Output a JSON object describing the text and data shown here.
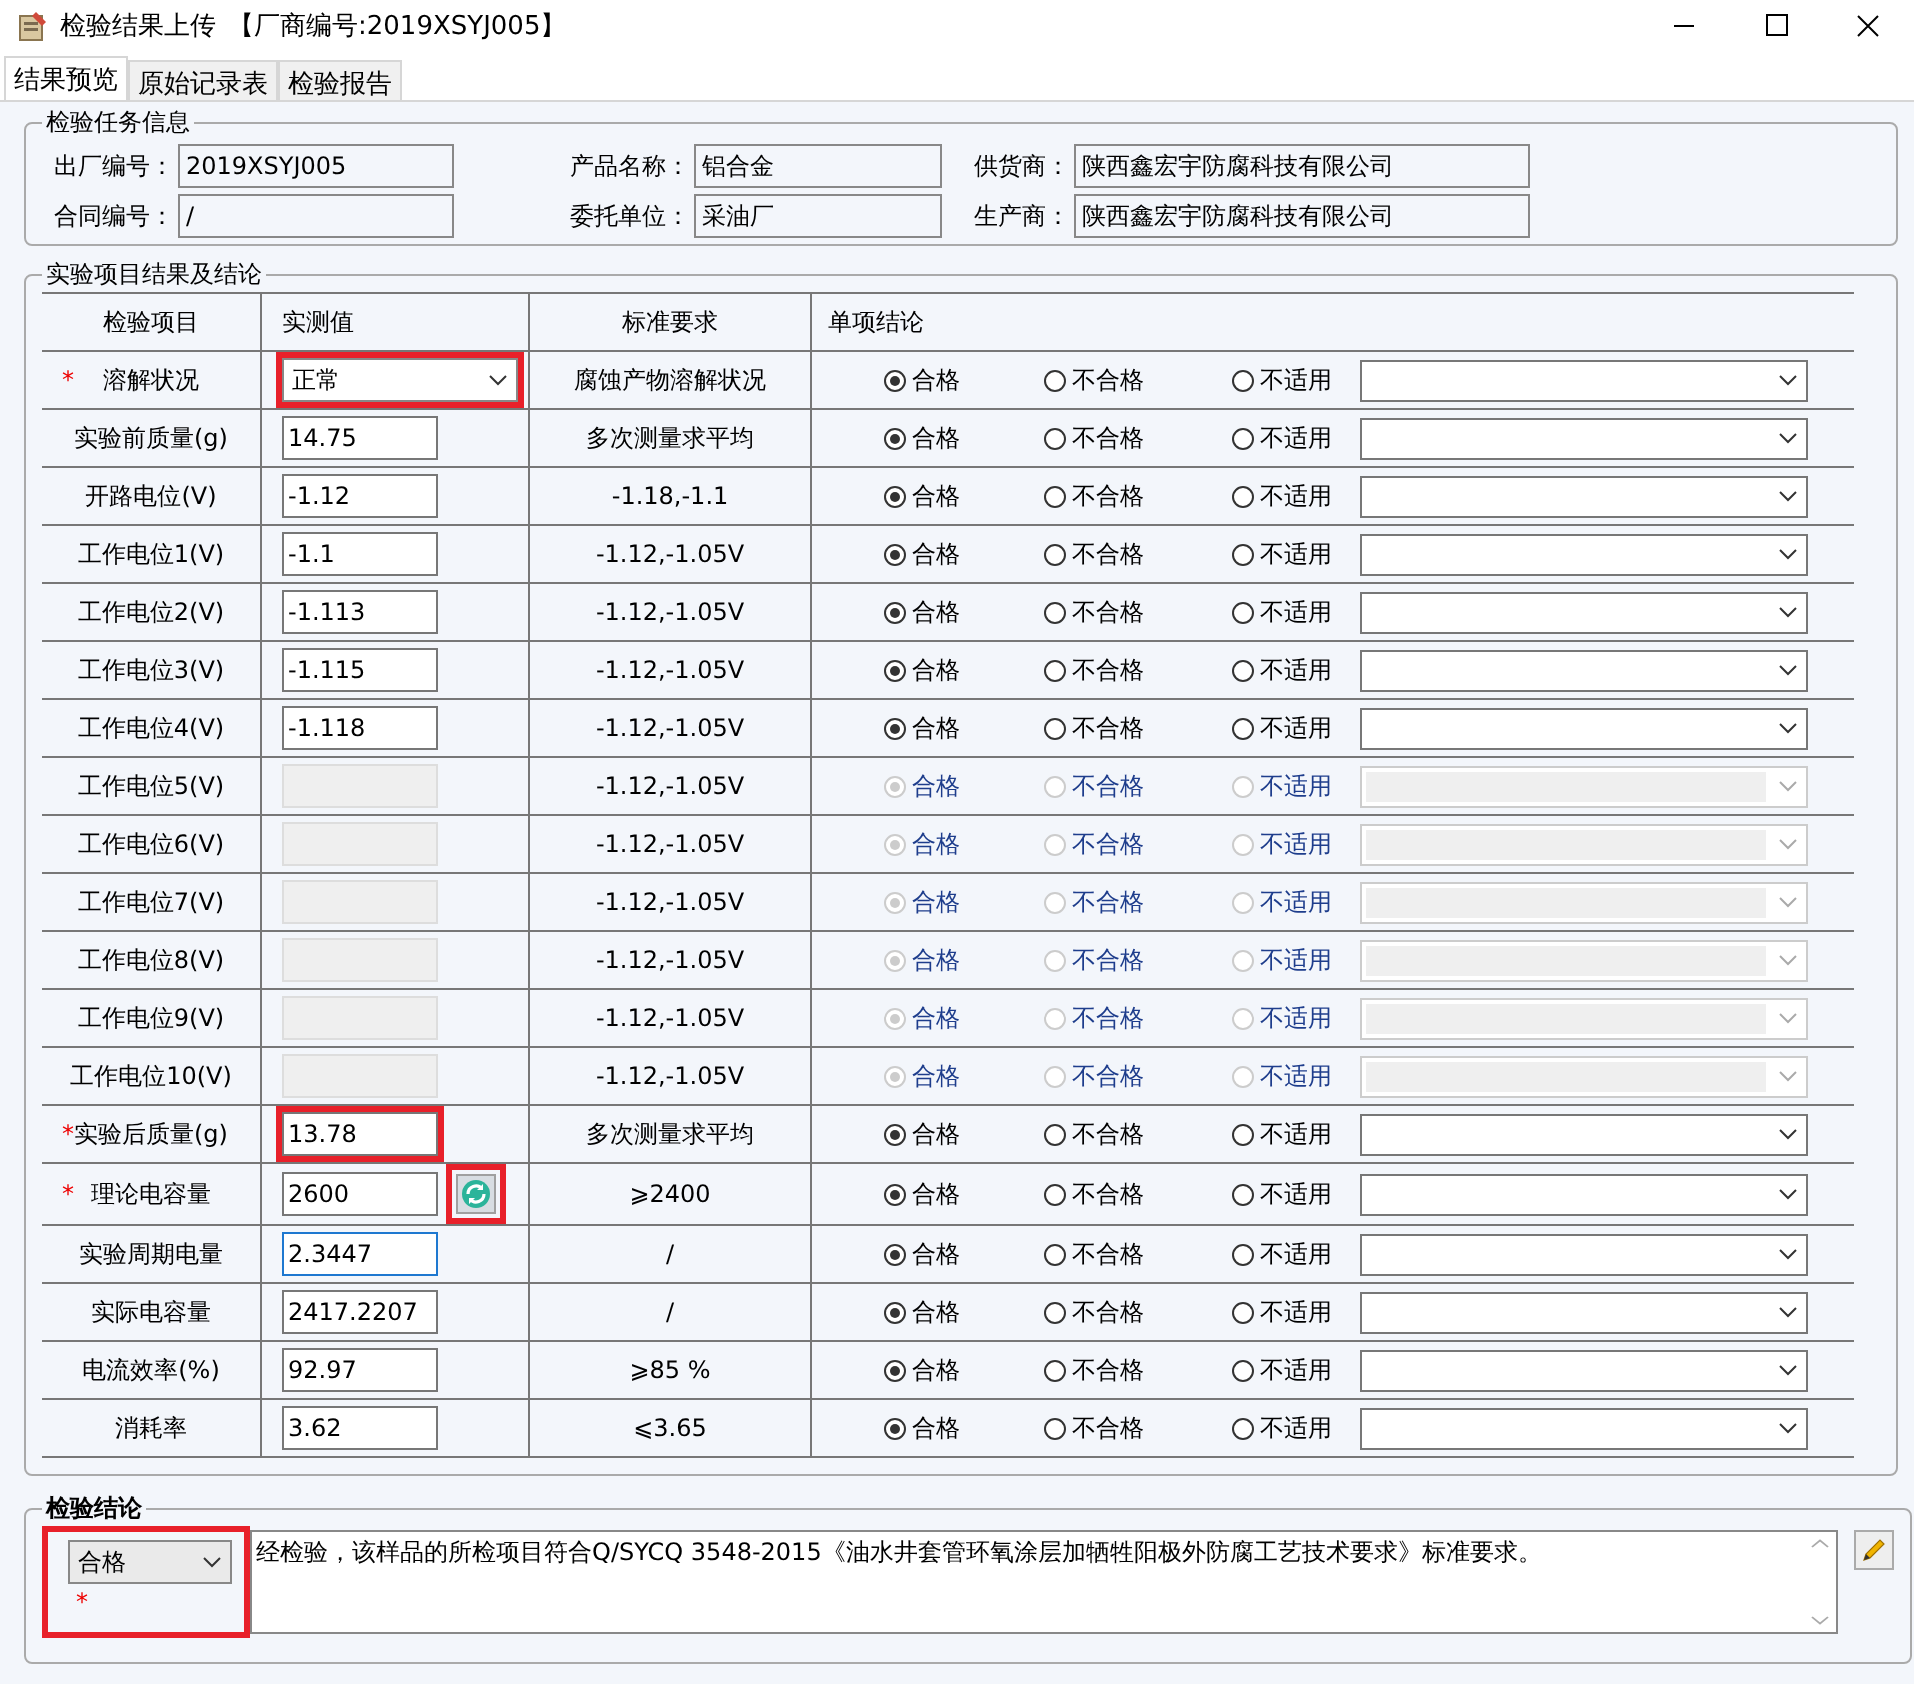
{
  "window": {
    "title": "检验结果上传",
    "subtitle": "【厂商编号:2019XSYJ005】"
  },
  "tabs": [
    {
      "label": "结果预览",
      "selected": true
    },
    {
      "label": "原始记录表",
      "selected": false
    },
    {
      "label": "检验报告",
      "selected": false
    }
  ],
  "task_info": {
    "title": "检验任务信息",
    "fields": [
      {
        "label": "出厂编号：",
        "value": "2019XSYJ005"
      },
      {
        "label": "产品名称：",
        "value": "铝合金"
      },
      {
        "label": "供货商：",
        "value": "陕西鑫宏宇防腐科技有限公司"
      },
      {
        "label": "合同编号：",
        "value": "/"
      },
      {
        "label": "委托单位：",
        "value": "采油厂"
      },
      {
        "label": "生产商：",
        "value": "陕西鑫宏宇防腐科技有限公司"
      }
    ]
  },
  "results": {
    "title": "实验项目结果及结论",
    "columns": [
      "检验项目",
      "实测值",
      "标准要求",
      "单项结论"
    ],
    "required_mark": "*",
    "rows": [
      {
        "item": "溶解状况",
        "kind": "select",
        "value": "正常",
        "standard": "腐蚀产物溶解状况",
        "required": true,
        "disabled": false,
        "highlighted": true,
        "focused": false,
        "refresh": false,
        "options": [
          {
            "label": "合格",
            "selected": true
          },
          {
            "label": "不合格",
            "selected": false
          },
          {
            "label": "不适用",
            "selected": false
          }
        ]
      },
      {
        "item": "实验前质量(g)",
        "kind": "input",
        "value": "14.75",
        "standard": "多次测量求平均",
        "required": false,
        "disabled": false,
        "highlighted": false,
        "focused": false,
        "refresh": false,
        "options": [
          {
            "label": "合格",
            "selected": true
          },
          {
            "label": "不合格",
            "selected": false
          },
          {
            "label": "不适用",
            "selected": false
          }
        ]
      },
      {
        "item": "开路电位(V)",
        "kind": "input",
        "value": "-1.12",
        "standard": "-1.18,-1.1",
        "required": false,
        "disabled": false,
        "highlighted": false,
        "focused": false,
        "refresh": false,
        "options": [
          {
            "label": "合格",
            "selected": true
          },
          {
            "label": "不合格",
            "selected": false
          },
          {
            "label": "不适用",
            "selected": false
          }
        ]
      },
      {
        "item": "工作电位1(V)",
        "kind": "input",
        "value": "-1.1",
        "standard": "-1.12,-1.05V",
        "required": false,
        "disabled": false,
        "highlighted": false,
        "focused": false,
        "refresh": false,
        "options": [
          {
            "label": "合格",
            "selected": true
          },
          {
            "label": "不合格",
            "selected": false
          },
          {
            "label": "不适用",
            "selected": false
          }
        ]
      },
      {
        "item": "工作电位2(V)",
        "kind": "input",
        "value": "-1.113",
        "standard": "-1.12,-1.05V",
        "required": false,
        "disabled": false,
        "highlighted": false,
        "focused": false,
        "refresh": false,
        "options": [
          {
            "label": "合格",
            "selected": true
          },
          {
            "label": "不合格",
            "selected": false
          },
          {
            "label": "不适用",
            "selected": false
          }
        ]
      },
      {
        "item": "工作电位3(V)",
        "kind": "input",
        "value": "-1.115",
        "standard": "-1.12,-1.05V",
        "required": false,
        "disabled": false,
        "highlighted": false,
        "focused": false,
        "refresh": false,
        "options": [
          {
            "label": "合格",
            "selected": true
          },
          {
            "label": "不合格",
            "selected": false
          },
          {
            "label": "不适用",
            "selected": false
          }
        ]
      },
      {
        "item": "工作电位4(V)",
        "kind": "input",
        "value": "-1.118",
        "standard": "-1.12,-1.05V",
        "required": false,
        "disabled": false,
        "highlighted": false,
        "focused": false,
        "refresh": false,
        "options": [
          {
            "label": "合格",
            "selected": true
          },
          {
            "label": "不合格",
            "selected": false
          },
          {
            "label": "不适用",
            "selected": false
          }
        ]
      },
      {
        "item": "工作电位5(V)",
        "kind": "input",
        "standard": "-1.12,-1.05V",
        "required": false,
        "disabled": true,
        "highlighted": false,
        "focused": false,
        "refresh": false,
        "options": [
          {
            "label": "合格",
            "selected": true
          },
          {
            "label": "不合格",
            "selected": false
          },
          {
            "label": "不适用",
            "selected": false
          }
        ]
      },
      {
        "item": "工作电位6(V)",
        "kind": "input",
        "standard": "-1.12,-1.05V",
        "required": false,
        "disabled": true,
        "highlighted": false,
        "focused": false,
        "refresh": false,
        "options": [
          {
            "label": "合格",
            "selected": true
          },
          {
            "label": "不合格",
            "selected": false
          },
          {
            "label": "不适用",
            "selected": false
          }
        ]
      },
      {
        "item": "工作电位7(V)",
        "kind": "input",
        "standard": "-1.12,-1.05V",
        "required": false,
        "disabled": true,
        "highlighted": false,
        "focused": false,
        "refresh": false,
        "options": [
          {
            "label": "合格",
            "selected": true
          },
          {
            "label": "不合格",
            "selected": false
          },
          {
            "label": "不适用",
            "selected": false
          }
        ]
      },
      {
        "item": "工作电位8(V)",
        "kind": "input",
        "standard": "-1.12,-1.05V",
        "required": false,
        "disabled": true,
        "highlighted": false,
        "focused": false,
        "refresh": false,
        "options": [
          {
            "label": "合格",
            "selected": true
          },
          {
            "label": "不合格",
            "selected": false
          },
          {
            "label": "不适用",
            "selected": false
          }
        ]
      },
      {
        "item": "工作电位9(V)",
        "kind": "input",
        "standard": "-1.12,-1.05V",
        "required": false,
        "disabled": true,
        "highlighted": false,
        "focused": false,
        "refresh": false,
        "options": [
          {
            "label": "合格",
            "selected": true
          },
          {
            "label": "不合格",
            "selected": false
          },
          {
            "label": "不适用",
            "selected": false
          }
        ]
      },
      {
        "item": "工作电位10(V)",
        "kind": "input",
        "standard": "-1.12,-1.05V",
        "required": false,
        "disabled": true,
        "highlighted": false,
        "focused": false,
        "refresh": false,
        "options": [
          {
            "label": "合格",
            "selected": true
          },
          {
            "label": "不合格",
            "selected": false
          },
          {
            "label": "不适用",
            "selected": false
          }
        ]
      },
      {
        "item": "实验后质量(g)",
        "kind": "input",
        "value": "13.78",
        "standard": "多次测量求平均",
        "required": true,
        "disabled": false,
        "highlighted": true,
        "focused": false,
        "refresh": false,
        "options": [
          {
            "label": "合格",
            "selected": true
          },
          {
            "label": "不合格",
            "selected": false
          },
          {
            "label": "不适用",
            "selected": false
          }
        ]
      },
      {
        "item": "理论电容量",
        "kind": "input",
        "value": "2600",
        "standard": "⩾2400",
        "required": true,
        "disabled": false,
        "highlighted": false,
        "focused": false,
        "refresh": true,
        "options": [
          {
            "label": "合格",
            "selected": true
          },
          {
            "label": "不合格",
            "selected": false
          },
          {
            "label": "不适用",
            "selected": false
          }
        ]
      },
      {
        "item": "实验周期电量",
        "kind": "input",
        "value": "2.3447",
        "standard": "/",
        "required": false,
        "disabled": false,
        "highlighted": false,
        "focused": true,
        "refresh": false,
        "options": [
          {
            "label": "合格",
            "selected": true
          },
          {
            "label": "不合格",
            "selected": false
          },
          {
            "label": "不适用",
            "selected": false
          }
        ]
      },
      {
        "item": "实际电容量",
        "kind": "input",
        "value": "2417.2207",
        "standard": "/",
        "required": false,
        "disabled": false,
        "highlighted": false,
        "focused": false,
        "refresh": false,
        "options": [
          {
            "label": "合格",
            "selected": true
          },
          {
            "label": "不合格",
            "selected": false
          },
          {
            "label": "不适用",
            "selected": false
          }
        ]
      },
      {
        "item": "电流效率(%)",
        "kind": "input",
        "value": "92.97",
        "standard": "⩾85  %",
        "required": false,
        "disabled": false,
        "highlighted": false,
        "focused": false,
        "refresh": false,
        "options": [
          {
            "label": "合格",
            "selected": true
          },
          {
            "label": "不合格",
            "selected": false
          },
          {
            "label": "不适用",
            "selected": false
          }
        ]
      },
      {
        "item": "消耗率",
        "kind": "input",
        "value": "3.62",
        "standard": "⩽3.65",
        "required": false,
        "disabled": false,
        "highlighted": false,
        "focused": false,
        "refresh": false,
        "options": [
          {
            "label": "合格",
            "selected": true
          },
          {
            "label": "不合格",
            "selected": false
          },
          {
            "label": "不适用",
            "selected": false
          }
        ]
      }
    ]
  },
  "conclusion": {
    "title": "检验结论",
    "result": "合格",
    "required_mark": "*",
    "highlighted": true,
    "text": "经检验，该样品的所检项目符合Q/SYCQ 3548-2015《油水井套管环氧涂层加牺牲阳极外防腐工艺技术要求》标准要求。"
  }
}
